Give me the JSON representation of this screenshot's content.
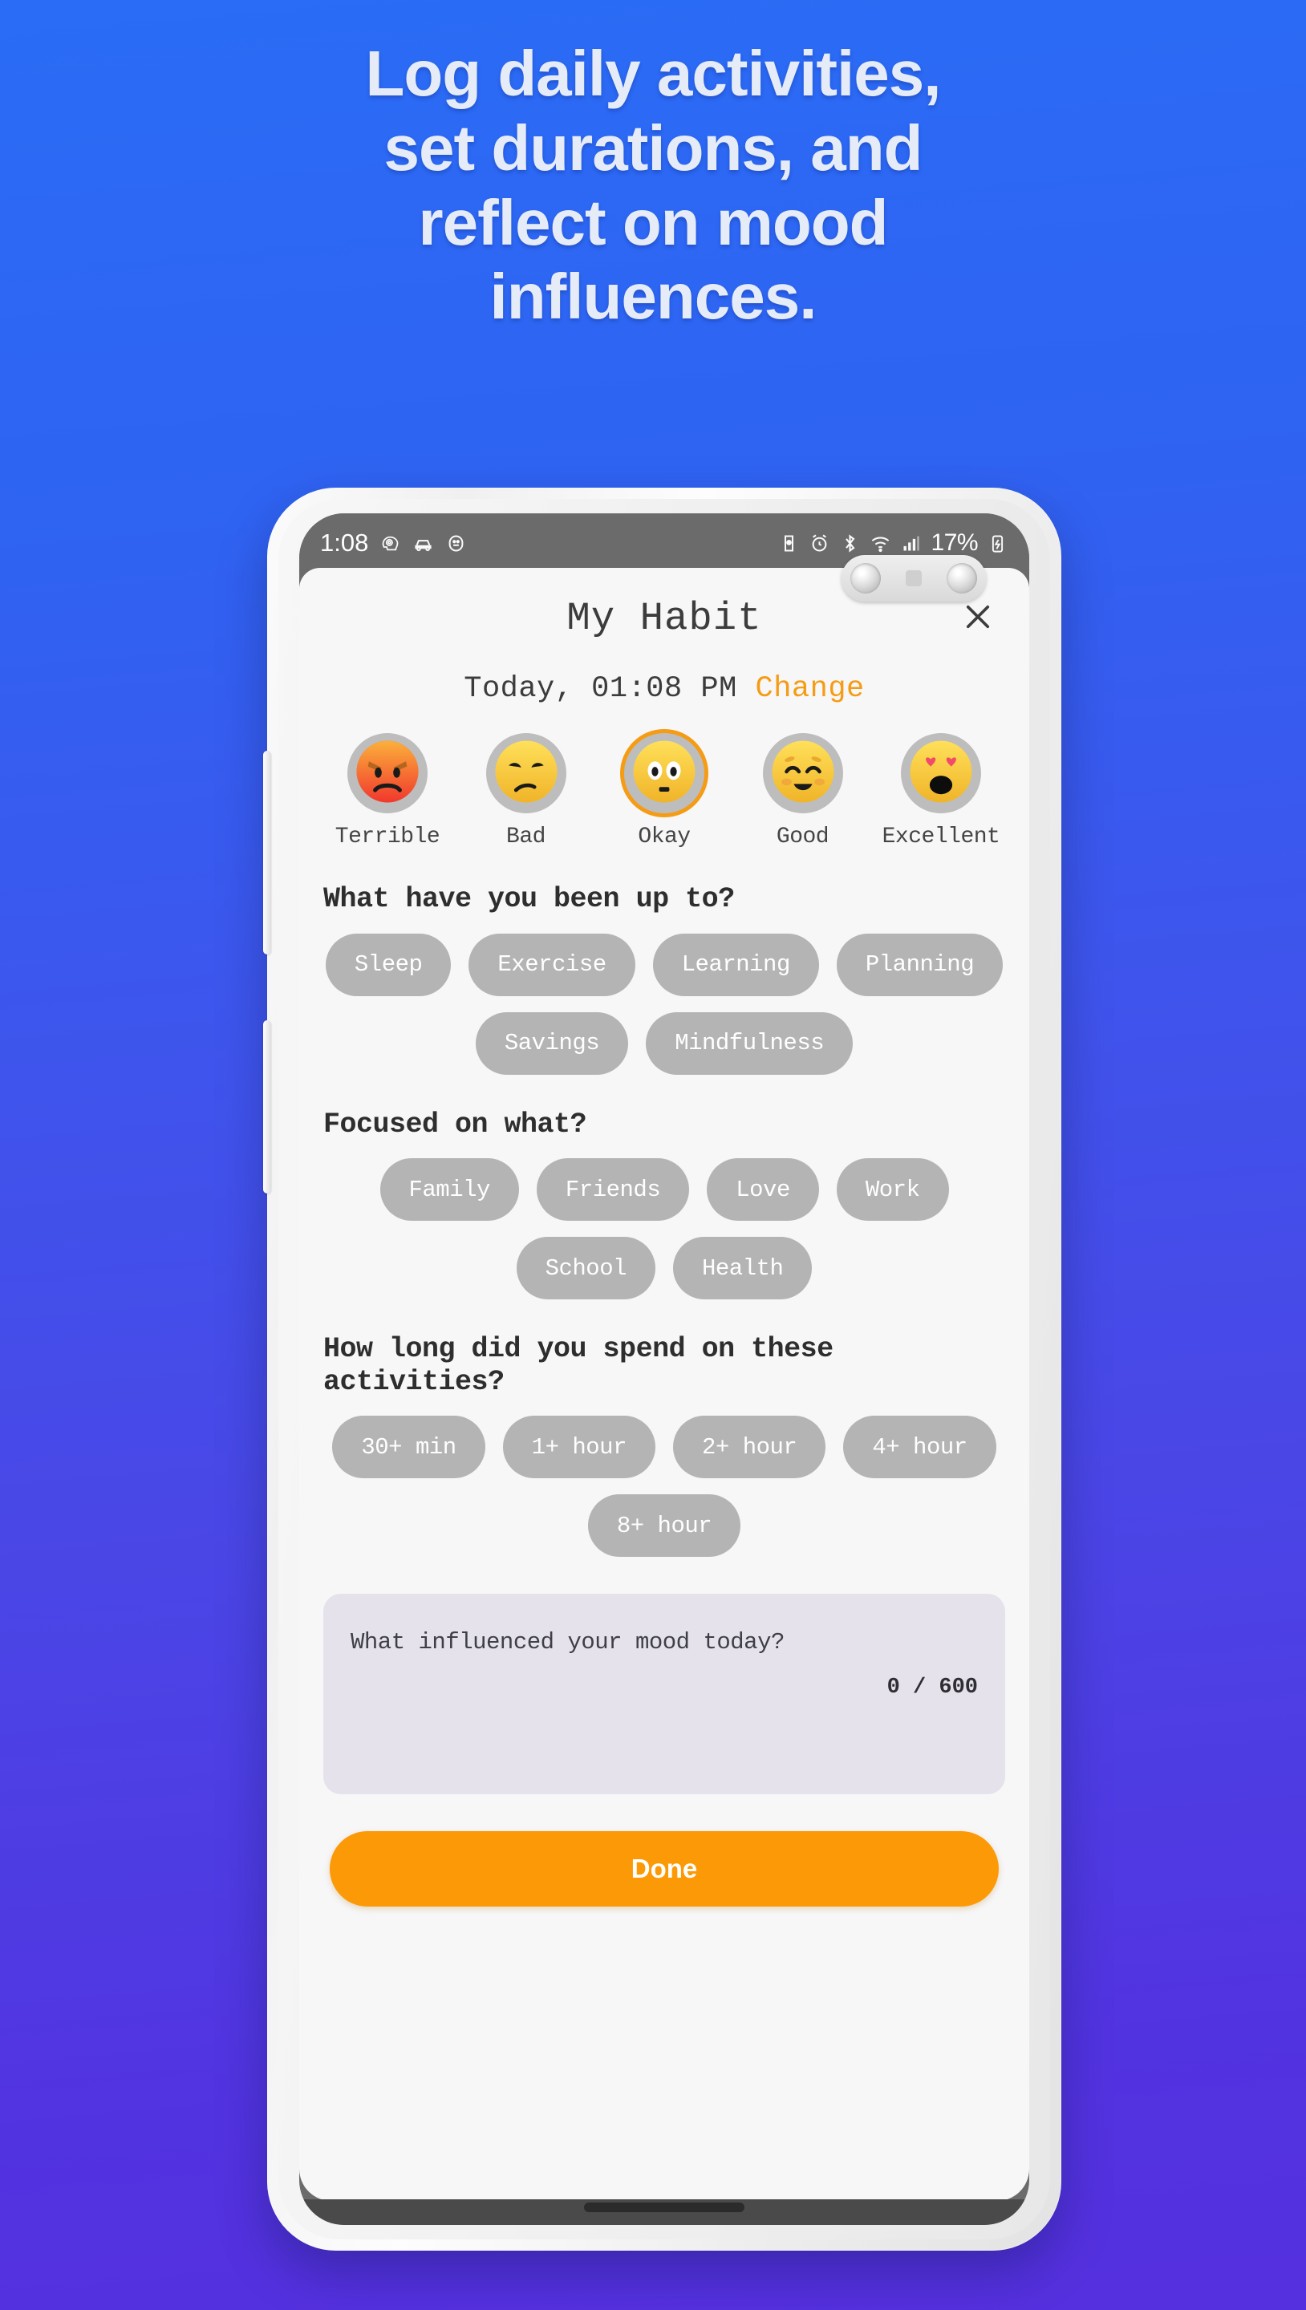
{
  "headline": {
    "lines": [
      "Log daily activities,",
      "set durations, and",
      "reflect on mood",
      "influences."
    ]
  },
  "colors": {
    "bg_top": "#2a6cf5",
    "bg_bottom": "#5233e0",
    "accent_orange": "#fb9a06",
    "change_link": "#f59c14",
    "chip_gray": "#b4b4b4",
    "note_bg": "#e6e2ec",
    "sheet_bg": "#f7f7f8"
  },
  "status_bar": {
    "time": "1:08",
    "left_icons": [
      "mind-head-icon",
      "car-icon",
      "face-icon"
    ],
    "right_icons": [
      "data-saver-icon",
      "alarm-icon",
      "bluetooth-icon",
      "wifi-icon",
      "signal-icon"
    ],
    "battery": "17%",
    "battery_icon": "battery-icon"
  },
  "app": {
    "title": "My Habit",
    "close_icon": "close-icon",
    "date": {
      "text": "Today, 01:08 PM",
      "change_label": "Change"
    },
    "moods": [
      {
        "label": "Terrible",
        "icon": "angry-face-icon",
        "selected": false
      },
      {
        "label": "Bad",
        "icon": "sad-face-icon",
        "selected": false
      },
      {
        "label": "Okay",
        "icon": "neutral-face-icon",
        "selected": true
      },
      {
        "label": "Good",
        "icon": "smiling-face-icon",
        "selected": false
      },
      {
        "label": "Excellent",
        "icon": "heart-eyes-face-icon",
        "selected": false
      }
    ],
    "activities": {
      "title": "What have you been up to?",
      "options": [
        "Sleep",
        "Exercise",
        "Learning",
        "Planning",
        "Savings",
        "Mindfulness"
      ]
    },
    "focus": {
      "title": "Focused on what?",
      "options": [
        "Family",
        "Friends",
        "Love",
        "Work",
        "School",
        "Health"
      ]
    },
    "duration": {
      "title": "How long did you spend on these activities?",
      "options": [
        "30+ min",
        "1+ hour",
        "2+ hour",
        "4+ hour",
        "8+ hour"
      ]
    },
    "note": {
      "placeholder": "What influenced your mood today?",
      "counter": "0 / 600",
      "max_length": 600
    },
    "done_label": "Done"
  }
}
